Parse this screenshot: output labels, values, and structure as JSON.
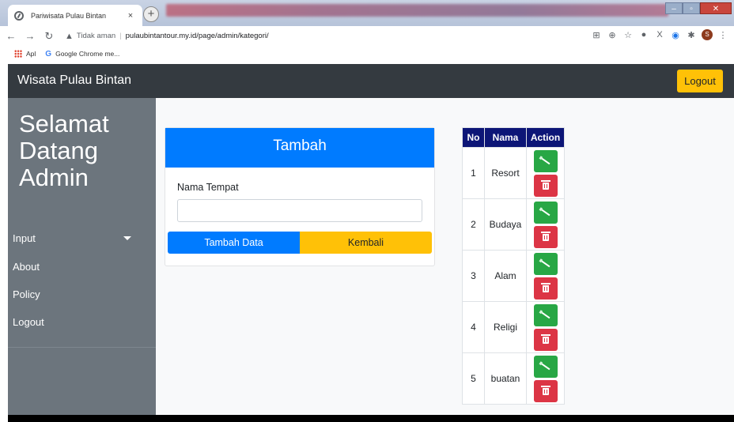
{
  "browser": {
    "tab_title": "Pariwisata Pulau Bintan",
    "tab_close": "×",
    "new_tab": "+",
    "security_label": "Tidak aman",
    "url": "pulaubintantour.my.id/page/admin/kategori/",
    "bookmarks": [
      {
        "label": "Apl",
        "icon": "apps-grid-icon"
      },
      {
        "label": "Google Chrome me...",
        "icon": "google-icon"
      }
    ],
    "profile_initial": "S"
  },
  "navbar": {
    "brand": "Wisata Pulau Bintan",
    "logout": "Logout"
  },
  "sidebar": {
    "welcome": "Selamat Datang Admin",
    "items": [
      {
        "label": "Input",
        "has_dropdown": true
      },
      {
        "label": "About"
      },
      {
        "label": "Policy"
      },
      {
        "label": "Logout"
      }
    ]
  },
  "form": {
    "header": "Tambah",
    "field_label": "Nama Tempat",
    "field_value": "",
    "submit_label": "Tambah Data",
    "back_label": "Kembali"
  },
  "table": {
    "columns": [
      "No",
      "Nama",
      "Action"
    ],
    "rows": [
      {
        "no": "1",
        "nama": "Resort"
      },
      {
        "no": "2",
        "nama": "Budaya"
      },
      {
        "no": "3",
        "nama": "Alam"
      },
      {
        "no": "4",
        "nama": "Religi"
      },
      {
        "no": "5",
        "nama": "buatan"
      }
    ]
  },
  "colors": {
    "navbar": "#343a40",
    "sidebar": "#6c757d",
    "primary": "#007bff",
    "warning": "#ffc107",
    "success": "#28a745",
    "danger": "#dc3545",
    "table_header": "#0d1677"
  }
}
